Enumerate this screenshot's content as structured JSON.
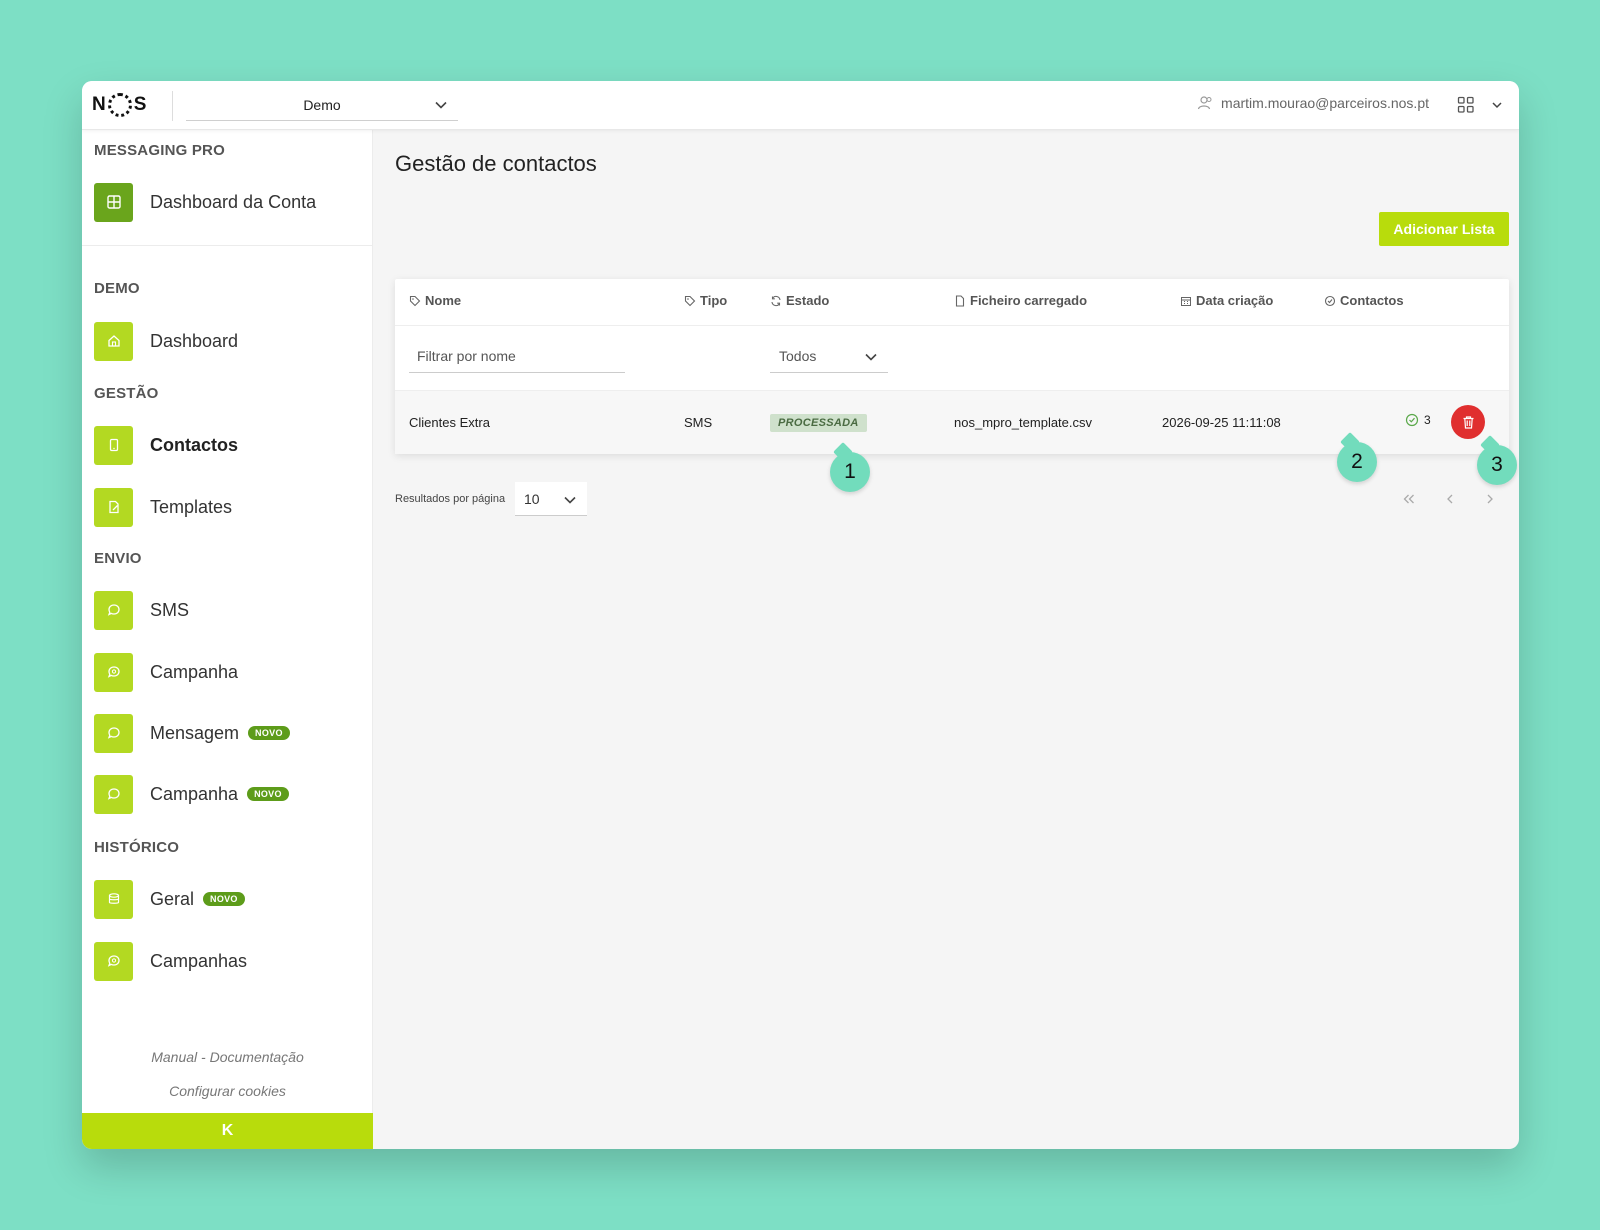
{
  "topbar": {
    "logo_left": "N",
    "logo_right": "S",
    "account": "Demo",
    "user_email": "martim.mourao@parceiros.nos.pt"
  },
  "sidebar": {
    "brand_section": "MESSAGING PRO",
    "account_dashboard": "Dashboard da Conta",
    "demo_section": "DEMO",
    "dashboard": "Dashboard",
    "gestao_section": "GESTÃO",
    "contactos": "Contactos",
    "templates": "Templates",
    "envio_section": "ENVIO",
    "sms": "SMS",
    "campanha": "Campanha",
    "mensagem": "Mensagem",
    "campanha_novo": "Campanha",
    "historico_section": "HISTÓRICO",
    "geral": "Geral",
    "campanhas": "Campanhas",
    "badge_novo": "NOVO",
    "manual_link": "Manual - Documentação",
    "cookies_link": "Configurar cookies",
    "collapse_icon": "K"
  },
  "main": {
    "title": "Gestão de contactos",
    "add_button": "Adicionar Lista",
    "columns": {
      "nome": "Nome",
      "tipo": "Tipo",
      "estado": "Estado",
      "ficheiro": "Ficheiro carregado",
      "data": "Data criação",
      "contactos": "Contactos"
    },
    "filter_placeholder": "Filtrar por nome",
    "state_filter": "Todos",
    "rows": [
      {
        "nome": "Clientes Extra",
        "tipo": "SMS",
        "estado": "PROCESSADA",
        "ficheiro": "nos_mpro_template.csv",
        "data": "2026-09-25 11:11:08",
        "contactos": "3"
      }
    ],
    "pagination": {
      "label": "Resultados por página",
      "per_page": "10"
    }
  },
  "markers": [
    "1",
    "2",
    "3"
  ],
  "colors": {
    "background": "#7ddfc5",
    "accent": "#b8dc0c",
    "nav_icon": "#b3d922",
    "delete": "#e02f2f",
    "marker": "#72dcbc"
  }
}
